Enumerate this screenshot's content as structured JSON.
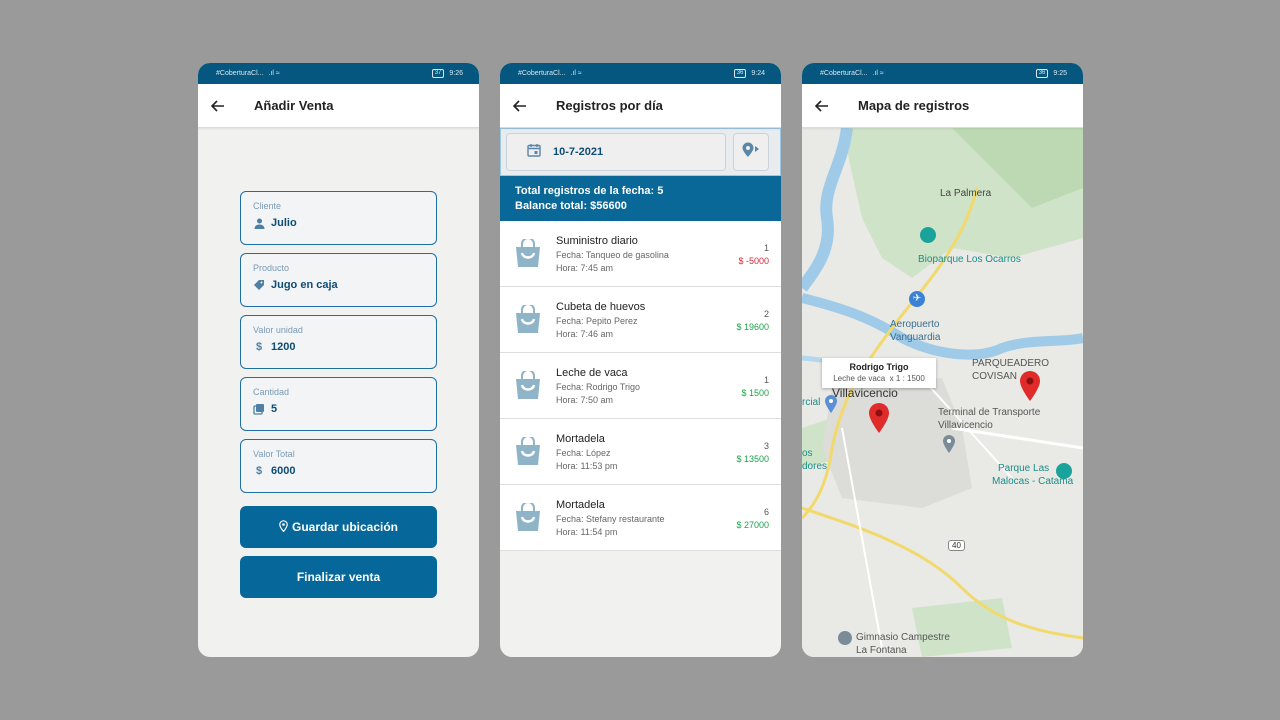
{
  "colors": {
    "primary": "#06679a",
    "status_bar": "#06577f",
    "positive": "#1aa34a",
    "negative": "#d9263a",
    "marker": "#e02b2b"
  },
  "status_bars": [
    {
      "carrier": "#CoberturaCl...",
      "battery": "37",
      "time": "9:26"
    },
    {
      "carrier": "#CoberturaCl...",
      "battery": "36",
      "time": "9:24"
    },
    {
      "carrier": "#CoberturaCl...",
      "battery": "36",
      "time": "9:25"
    }
  ],
  "add_sale": {
    "title": "Añadir Venta",
    "fields": [
      {
        "label": "Cliente",
        "value": "Julio",
        "icon": "person-icon"
      },
      {
        "label": "Producto",
        "value": "Jugo en caja",
        "icon": "tag-icon"
      },
      {
        "label": "Valor unidad",
        "value": "1200",
        "icon": "dollar-icon"
      },
      {
        "label": "Cantidad",
        "value": "5",
        "icon": "stack-icon"
      },
      {
        "label": "Valor Total",
        "value": "6000",
        "icon": "dollar-icon"
      }
    ],
    "save_location_label": "Guardar ubicación",
    "finish_label": "Finalizar venta"
  },
  "daily_records": {
    "title": "Registros por día",
    "date": "10-7-2021",
    "summary_count": "Total registros de la fecha: 5",
    "summary_balance": "Balance total: $56600",
    "records": [
      {
        "name": "Suministro diario",
        "fecha": "Fecha: Tanqueo de gasolina",
        "hora": "Hora: 7:45 am",
        "qty": "1",
        "amount": "$ -5000",
        "positive": false
      },
      {
        "name": "Cubeta de huevos",
        "fecha": "Fecha: Pepito Perez",
        "hora": "Hora: 7:46 am",
        "qty": "2",
        "amount": "$ 19600",
        "positive": true
      },
      {
        "name": "Leche de vaca",
        "fecha": "Fecha: Rodrigo Trigo",
        "hora": "Hora: 7:50 am",
        "qty": "1",
        "amount": "$ 1500",
        "positive": true
      },
      {
        "name": "Mortadela",
        "fecha": "Fecha: López",
        "hora": "Hora: 11:53 pm",
        "qty": "3",
        "amount": "$ 13500",
        "positive": true
      },
      {
        "name": "Mortadela",
        "fecha": "Fecha: Stefany restaurante",
        "hora": "Hora: 11:54 pm",
        "qty": "6",
        "amount": "$ 27000",
        "positive": true
      }
    ]
  },
  "records_map": {
    "title": "Mapa de registros",
    "info_window": {
      "title": "Rodrigo Trigo",
      "detail": "Leche de vaca  x 1 : 1500"
    },
    "places": {
      "la_palmera": "La Palmera",
      "bioparque": "Bioparque Los Ocarros",
      "aeropuerto_1": "Aeropuerto",
      "aeropuerto_2": "Vanguardia",
      "parqueadero_1": "PARQUEADERO",
      "parqueadero_2": "COVISAN",
      "terminal_1": "Terminal de Transporte",
      "terminal_2": "Villavicencio",
      "villavicencio": "Villavicencio",
      "parque_1": "Parque Las",
      "parque_2": "Malocas - Catama",
      "gimnasio_1": "Gimnasio Campestre",
      "gimnasio_2": "La Fontana",
      "route": "40",
      "edge_1": "rcial",
      "edge_2": "os",
      "edge_3": "dores"
    }
  }
}
